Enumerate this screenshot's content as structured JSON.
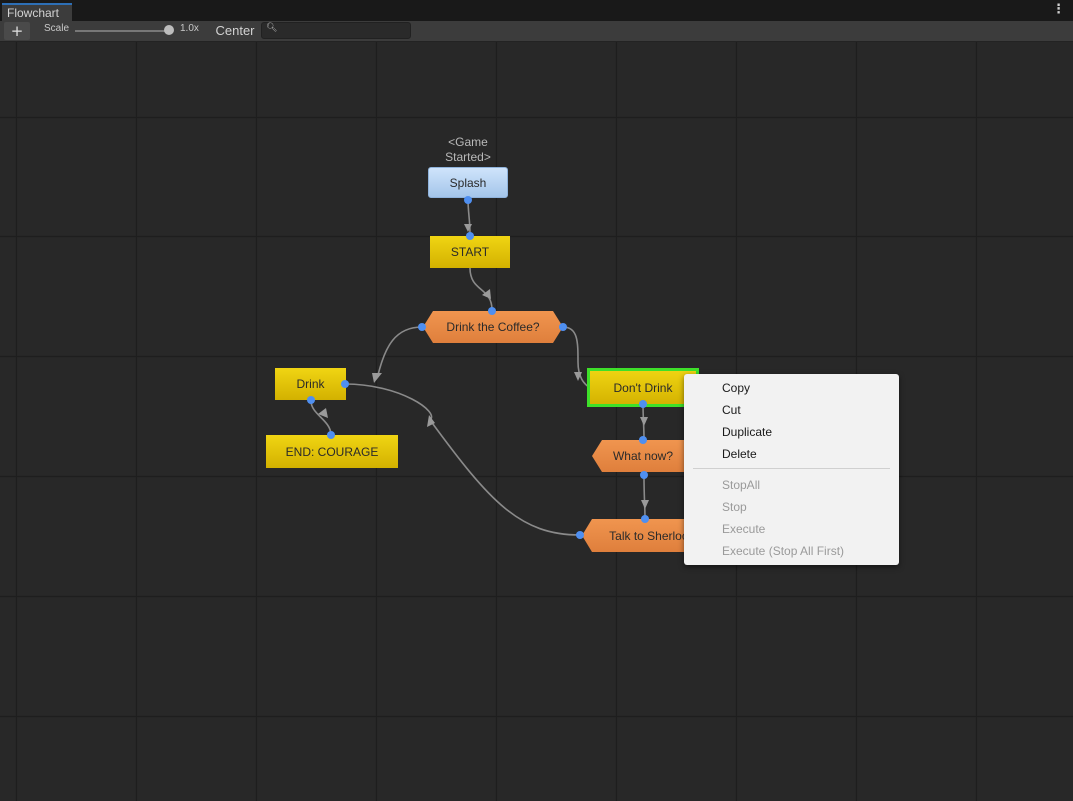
{
  "window": {
    "tab_title": "Flowchart",
    "menu_icon": "more-vert-icon"
  },
  "toolbar": {
    "add_label": "+",
    "scale_label": "Scale",
    "scale_value": "1.0x",
    "scale_level": 1.0,
    "center_label": "Center",
    "search_value": "",
    "search_icon": "search-icon"
  },
  "blocks": {
    "splash": {
      "label": "Splash",
      "caption": "<Game Started>"
    },
    "start": {
      "label": "START"
    },
    "drink_coffee": {
      "label": "Drink the Coffee?"
    },
    "drink": {
      "label": "Drink"
    },
    "end_courage": {
      "label": "END: COURAGE"
    },
    "dont_drink": {
      "label": "Don't Drink"
    },
    "what_now": {
      "label": "What now?"
    },
    "talk_sherlock": {
      "label": "Talk to Sherlock"
    }
  },
  "colors": {
    "event_block": "#b8d3f2",
    "block": "#e5c70a",
    "branch_block": "#e8884a",
    "selected_outline": "#3ee02a",
    "connector": "#4f8ff0"
  },
  "context_menu": {
    "items": [
      {
        "label": "Copy",
        "enabled": true
      },
      {
        "label": "Cut",
        "enabled": true
      },
      {
        "label": "Duplicate",
        "enabled": true
      },
      {
        "label": "Delete",
        "enabled": true
      },
      {
        "label": "StopAll",
        "enabled": false
      },
      {
        "label": "Stop",
        "enabled": false
      },
      {
        "label": "Execute",
        "enabled": false
      },
      {
        "label": "Execute (Stop All First)",
        "enabled": false
      }
    ]
  }
}
